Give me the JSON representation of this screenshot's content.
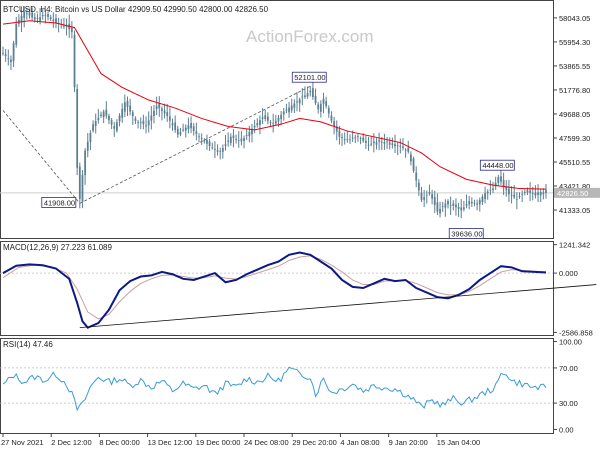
{
  "header": {
    "symbol_line": "BTCUSD, H4:  Bitcoin vs US Dollar  42909.50 42990.50 42800.00 42826.50"
  },
  "watermark": "ActionForex.com",
  "colors": {
    "candle": "#5b7f92",
    "ma": "#e8000b",
    "macd_main": "#0b1a84",
    "macd_signal": "#c9a0a0",
    "rsi": "#3a9bd6",
    "trend": "#111111",
    "price_tag": "#b7b7b7"
  },
  "chart_data": [
    {
      "type": "candlestick",
      "title": "BTCUSD, H4:  Bitcoin vs US Dollar  42909.50 42990.50 42800.00 42826.50",
      "ylim": [
        38900,
        59600
      ],
      "y_ticks": [
        "58043.05",
        "55954.30",
        "53865.55",
        "51776.80",
        "49688.05",
        "47599.30",
        "45510.55",
        "43421.80",
        "41333.05"
      ],
      "y_tick_values": [
        58043.05,
        55954.3,
        53865.55,
        51776.8,
        49688.05,
        47599.3,
        45510.55,
        43421.8,
        41333.05
      ],
      "current_price_label": "42826.50",
      "current_price": 42826.5,
      "x_ticks": [
        "27 Nov 2021",
        "2 Dec 12:00",
        "8 Dec 00:00",
        "13 Dec 12:00",
        "19 Dec 00:00",
        "24 Dec 08:00",
        "29 Dec 20:00",
        "4 Jan 08:00",
        "9 Jan 20:00",
        "15 Jan 04:00"
      ],
      "price_path": [
        [
          0,
          55000
        ],
        [
          3,
          54200
        ],
        [
          5,
          57500
        ],
        [
          8,
          58600
        ],
        [
          12,
          57900
        ],
        [
          16,
          58300
        ],
        [
          20,
          57600
        ],
        [
          24,
          57300
        ],
        [
          26,
          56800
        ],
        [
          27,
          52000
        ],
        [
          28,
          45000
        ],
        [
          29,
          42300
        ],
        [
          31,
          46500
        ],
        [
          34,
          48800
        ],
        [
          38,
          49900
        ],
        [
          42,
          48400
        ],
        [
          46,
          50700
        ],
        [
          50,
          49100
        ],
        [
          54,
          48700
        ],
        [
          58,
          50400
        ],
        [
          62,
          49500
        ],
        [
          66,
          47900
        ],
        [
          70,
          48700
        ],
        [
          74,
          47700
        ],
        [
          78,
          46900
        ],
        [
          82,
          46400
        ],
        [
          86,
          47700
        ],
        [
          90,
          47300
        ],
        [
          94,
          48400
        ],
        [
          98,
          49400
        ],
        [
          102,
          48800
        ],
        [
          106,
          49900
        ],
        [
          110,
          50600
        ],
        [
          114,
          51300
        ],
        [
          116,
          51700
        ],
        [
          119,
          50100
        ],
        [
          121,
          51000
        ],
        [
          124,
          49100
        ],
        [
          127,
          47700
        ],
        [
          130,
          47400
        ],
        [
          134,
          47700
        ],
        [
          138,
          47000
        ],
        [
          142,
          47300
        ],
        [
          146,
          47200
        ],
        [
          150,
          46900
        ],
        [
          153,
          46400
        ],
        [
          156,
          43900
        ],
        [
          158,
          42200
        ],
        [
          161,
          42900
        ],
        [
          164,
          41200
        ],
        [
          167,
          41900
        ],
        [
          170,
          41700
        ],
        [
          173,
          41300
        ],
        [
          176,
          42100
        ],
        [
          179,
          41900
        ],
        [
          182,
          42800
        ],
        [
          185,
          43200
        ],
        [
          187,
          44200
        ],
        [
          189,
          43400
        ],
        [
          191,
          42700
        ],
        [
          194,
          42300
        ],
        [
          197,
          42900
        ],
        [
          200,
          42800
        ],
        [
          203,
          42900
        ],
        [
          205,
          42826
        ]
      ],
      "moving_average": [
        [
          0,
          57500
        ],
        [
          10,
          57800
        ],
        [
          20,
          57600
        ],
        [
          27,
          57200
        ],
        [
          32,
          55200
        ],
        [
          37,
          53200
        ],
        [
          45,
          52000
        ],
        [
          55,
          50900
        ],
        [
          65,
          50200
        ],
        [
          75,
          49300
        ],
        [
          85,
          48600
        ],
        [
          95,
          48300
        ],
        [
          105,
          48800
        ],
        [
          112,
          49300
        ],
        [
          120,
          49000
        ],
        [
          130,
          48200
        ],
        [
          140,
          47700
        ],
        [
          150,
          47200
        ],
        [
          158,
          46300
        ],
        [
          165,
          45100
        ],
        [
          175,
          44000
        ],
        [
          185,
          43500
        ],
        [
          195,
          43200
        ],
        [
          205,
          43150
        ]
      ],
      "annotations": [
        {
          "text": "41908.00",
          "x": 29,
          "y": 41908
        },
        {
          "text": "52101.00",
          "x": 116,
          "y": 52101
        },
        {
          "text": "44448.00",
          "x": 187,
          "y": 44448
        },
        {
          "text": "39636.00",
          "x": 173,
          "y": 39636
        }
      ],
      "dashed_lines": [
        {
          "points": [
            [
              0,
              50000
            ],
            [
              29,
              41908
            ]
          ]
        },
        {
          "points": [
            [
              29,
              41908
            ],
            [
              116,
              52101
            ]
          ]
        }
      ],
      "h_line_price": 42826.5
    },
    {
      "type": "line",
      "title": "MACD(12,26,9) 27.223 61.089",
      "ylim": [
        -2700,
        1400
      ],
      "y_ticks": [
        "1241.342",
        "0.000",
        "-2586.858"
      ],
      "y_tick_values": [
        1241.342,
        0,
        -2586.858
      ],
      "series": [
        {
          "role": "main",
          "points": [
            [
              0,
              0
            ],
            [
              5,
              320
            ],
            [
              10,
              380
            ],
            [
              15,
              340
            ],
            [
              20,
              200
            ],
            [
              25,
              -250
            ],
            [
              28,
              -1300
            ],
            [
              30,
              -2100
            ],
            [
              32,
              -2380
            ],
            [
              36,
              -2180
            ],
            [
              40,
              -1600
            ],
            [
              44,
              -750
            ],
            [
              48,
              -350
            ],
            [
              52,
              -150
            ],
            [
              56,
              -100
            ],
            [
              60,
              50
            ],
            [
              64,
              -50
            ],
            [
              68,
              -250
            ],
            [
              72,
              -300
            ],
            [
              76,
              -150
            ],
            [
              80,
              0
            ],
            [
              84,
              -400
            ],
            [
              88,
              -300
            ],
            [
              92,
              -50
            ],
            [
              96,
              150
            ],
            [
              100,
              350
            ],
            [
              104,
              500
            ],
            [
              108,
              800
            ],
            [
              112,
              900
            ],
            [
              116,
              800
            ],
            [
              120,
              500
            ],
            [
              124,
              200
            ],
            [
              128,
              -300
            ],
            [
              132,
              -600
            ],
            [
              136,
              -650
            ],
            [
              140,
              -450
            ],
            [
              144,
              -250
            ],
            [
              148,
              -350
            ],
            [
              152,
              -300
            ],
            [
              156,
              -650
            ],
            [
              160,
              -850
            ],
            [
              164,
              -1050
            ],
            [
              168,
              -1100
            ],
            [
              172,
              -950
            ],
            [
              176,
              -700
            ],
            [
              180,
              -300
            ],
            [
              184,
              0
            ],
            [
              188,
              300
            ],
            [
              192,
              250
            ],
            [
              196,
              80
            ],
            [
              200,
              60
            ],
            [
              205,
              27
            ]
          ]
        },
        {
          "role": "signal",
          "points": [
            [
              0,
              -200
            ],
            [
              6,
              250
            ],
            [
              12,
              350
            ],
            [
              18,
              280
            ],
            [
              24,
              0
            ],
            [
              28,
              -700
            ],
            [
              32,
              -1700
            ],
            [
              36,
              -2000
            ],
            [
              40,
              -1800
            ],
            [
              44,
              -1250
            ],
            [
              48,
              -800
            ],
            [
              52,
              -450
            ],
            [
              56,
              -250
            ],
            [
              60,
              -100
            ],
            [
              64,
              -80
            ],
            [
              68,
              -150
            ],
            [
              72,
              -220
            ],
            [
              76,
              -200
            ],
            [
              80,
              -120
            ],
            [
              84,
              -220
            ],
            [
              88,
              -260
            ],
            [
              92,
              -150
            ],
            [
              96,
              0
            ],
            [
              100,
              150
            ],
            [
              104,
              300
            ],
            [
              108,
              550
            ],
            [
              112,
              700
            ],
            [
              116,
              750
            ],
            [
              120,
              600
            ],
            [
              124,
              350
            ],
            [
              128,
              50
            ],
            [
              132,
              -300
            ],
            [
              136,
              -500
            ],
            [
              140,
              -500
            ],
            [
              144,
              -350
            ],
            [
              148,
              -330
            ],
            [
              152,
              -320
            ],
            [
              156,
              -450
            ],
            [
              160,
              -650
            ],
            [
              164,
              -850
            ],
            [
              168,
              -950
            ],
            [
              172,
              -950
            ],
            [
              176,
              -800
            ],
            [
              180,
              -550
            ],
            [
              184,
              -250
            ],
            [
              188,
              50
            ],
            [
              192,
              150
            ],
            [
              196,
              120
            ],
            [
              200,
              80
            ],
            [
              205,
              61
            ]
          ]
        }
      ],
      "trendline": [
        [
          29,
          -2380
        ],
        [
          224,
          -500
        ]
      ]
    },
    {
      "type": "line",
      "title": "RSI(14) 47.46",
      "ylim": [
        0,
        100
      ],
      "y_ticks": [
        "100.00",
        "70.00",
        "30.00",
        "0.00"
      ],
      "y_tick_values": [
        100,
        70,
        30,
        0
      ],
      "levels": [
        70,
        30
      ],
      "series": [
        {
          "role": "rsi",
          "points": [
            [
              0,
              50
            ],
            [
              4,
              62
            ],
            [
              8,
              54
            ],
            [
              12,
              60
            ],
            [
              16,
              56
            ],
            [
              20,
              63
            ],
            [
              24,
              52
            ],
            [
              26,
              40
            ],
            [
              28,
              23
            ],
            [
              30,
              28
            ],
            [
              33,
              48
            ],
            [
              36,
              60
            ],
            [
              40,
              54
            ],
            [
              44,
              58
            ],
            [
              48,
              50
            ],
            [
              52,
              56
            ],
            [
              56,
              48
            ],
            [
              60,
              55
            ],
            [
              64,
              44
            ],
            [
              68,
              52
            ],
            [
              72,
              46
            ],
            [
              76,
              50
            ],
            [
              80,
              40
            ],
            [
              84,
              52
            ],
            [
              88,
              48
            ],
            [
              92,
              58
            ],
            [
              96,
              54
            ],
            [
              100,
              60
            ],
            [
              104,
              55
            ],
            [
              108,
              69
            ],
            [
              112,
              63
            ],
            [
              116,
              60
            ],
            [
              118,
              40
            ],
            [
              121,
              58
            ],
            [
              124,
              42
            ],
            [
              128,
              46
            ],
            [
              132,
              52
            ],
            [
              136,
              44
            ],
            [
              140,
              50
            ],
            [
              144,
              48
            ],
            [
              148,
              46
            ],
            [
              152,
              40
            ],
            [
              156,
              32
            ],
            [
              158,
              25
            ],
            [
              162,
              33
            ],
            [
              166,
              28
            ],
            [
              170,
              35
            ],
            [
              174,
              30
            ],
            [
              178,
              36
            ],
            [
              182,
              42
            ],
            [
              186,
              48
            ],
            [
              188,
              62
            ],
            [
              190,
              65
            ],
            [
              192,
              55
            ],
            [
              196,
              52
            ],
            [
              200,
              48
            ],
            [
              205,
              47.46
            ]
          ]
        }
      ]
    }
  ]
}
